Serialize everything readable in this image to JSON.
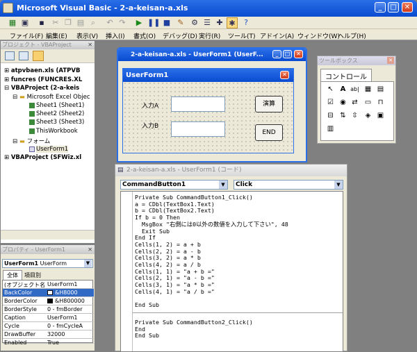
{
  "app": {
    "title": "Microsoft Visual Basic - 2-a-keisan-a.xls"
  },
  "menu": [
    "ファイル(F)",
    "編集(E)",
    "表示(V)",
    "挿入(I)",
    "書式(O)",
    "デバッグ(D)",
    "実行(R)",
    "ツール(T)",
    "アドイン(A)",
    "ウィンドウ(W)",
    "ヘルプ(H)"
  ],
  "project": {
    "title": "プロジェクト - VBAProject",
    "items": [
      "atpvbaen.xls (ATPVB",
      "funcres (FUNCRES.XL",
      "VBAProject (2-a-keis",
      "Microsoft Excel Objec",
      "Sheet1 (Sheet1)",
      "Sheet2 (Sheet2)",
      "Sheet3 (Sheet3)",
      "ThisWorkbook",
      "フォーム",
      "UserForm1",
      "VBAProject (SFWiz.xl"
    ]
  },
  "properties": {
    "title": "プロパティ - UserForm1",
    "object": "UserForm1",
    "object_type": "UserForm",
    "tabs": [
      "全体",
      "項目別"
    ],
    "rows": [
      [
        "(オブジェクト名)",
        "UserForm1"
      ],
      [
        "BackColor",
        "&H8000"
      ],
      [
        "BorderColor",
        "&H800000"
      ],
      [
        "BorderStyle",
        "0 - fmBorder"
      ],
      [
        "Caption",
        "UserForm1"
      ],
      [
        "Cycle",
        "0 - fmCycleA"
      ],
      [
        "DrawBuffer",
        "32000"
      ],
      [
        "Enabled",
        "True"
      ]
    ]
  },
  "form_window": {
    "title": "2-a-keisan-a.xls - UserForm1 (UserF...",
    "form_title": "UserForm1",
    "label1": "入力A",
    "label2": "入力B",
    "button1": "演算",
    "button2": "END"
  },
  "toolbox": {
    "title": "ツールボックス",
    "tab": "コントロール"
  },
  "code_window": {
    "title": "2-a-keisan-a.xls - UserForm1 (コード)",
    "object": "CommandButton1",
    "procedure": "Click",
    "lines": [
      "Private Sub CommandButton1_Click()",
      "a = CDbl(TextBox1.Text)",
      "b = CDbl(TextBox2.Text)",
      "If b = 0 Then",
      "  MsgBox \"右側には0以外の数値を入力して下さい\", 48",
      "  Exit Sub",
      "End If",
      "Cells(1, 2) = a + b",
      "Cells(2, 2) = a - b",
      "Cells(3, 2) = a * b",
      "Cells(4, 2) = a / b",
      "Cells(1, 1) = \"a + b =\"",
      "Cells(2, 1) = \"a - b =\"",
      "Cells(3, 1) = \"a * b =\"",
      "Cells(4, 1) = \"a / b =\"",
      "",
      "End Sub"
    ],
    "lines2": [
      "Private Sub CommandButton2_Click()",
      "End",
      "End Sub"
    ]
  }
}
